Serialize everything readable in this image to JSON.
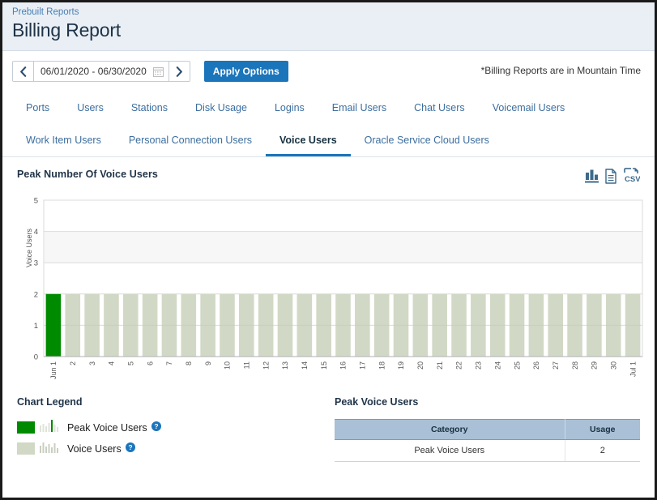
{
  "header": {
    "breadcrumb": "Prebuilt Reports",
    "title": "Billing Report"
  },
  "controls": {
    "prev_label": "‹",
    "next_label": "›",
    "date_range": "06/01/2020 - 06/30/2020",
    "calendar_icon": "calendar-icon",
    "apply_label": "Apply Options",
    "timezone_note": "*Billing Reports are in Mountain Time"
  },
  "tabs": {
    "row1": [
      {
        "label": "Ports",
        "active": false
      },
      {
        "label": "Users",
        "active": false
      },
      {
        "label": "Stations",
        "active": false
      },
      {
        "label": "Disk Usage",
        "active": false
      },
      {
        "label": "Logins",
        "active": false
      },
      {
        "label": "Email Users",
        "active": false
      },
      {
        "label": "Chat Users",
        "active": false
      },
      {
        "label": "Voicemail Users",
        "active": false
      }
    ],
    "row2": [
      {
        "label": "Work Item Users",
        "active": false
      },
      {
        "label": "Personal Connection Users",
        "active": false
      },
      {
        "label": "Voice Users",
        "active": true
      },
      {
        "label": "Oracle Service Cloud Users",
        "active": false
      }
    ]
  },
  "chart_panel": {
    "title": "Peak Number Of Voice Users",
    "actions": [
      {
        "name": "bar-chart-icon",
        "label": ""
      },
      {
        "name": "document-icon",
        "label": ""
      },
      {
        "name": "csv-icon",
        "label": "CSV"
      }
    ]
  },
  "chart_data": {
    "type": "bar",
    "title": "Peak Number Of Voice Users",
    "xlabel": "",
    "ylabel": "Voice Users",
    "ylim": [
      0,
      5
    ],
    "yticks": [
      0,
      1,
      2,
      3,
      4,
      5
    ],
    "grid": true,
    "legend_position": "below",
    "categories": [
      "Jun 1",
      "2",
      "3",
      "4",
      "5",
      "6",
      "7",
      "8",
      "9",
      "10",
      "11",
      "12",
      "13",
      "14",
      "15",
      "16",
      "17",
      "18",
      "19",
      "20",
      "21",
      "22",
      "23",
      "24",
      "25",
      "26",
      "27",
      "28",
      "29",
      "30",
      "Jul 1"
    ],
    "values": [
      2,
      2,
      2,
      2,
      2,
      2,
      2,
      2,
      2,
      2,
      2,
      2,
      2,
      2,
      2,
      2,
      2,
      2,
      2,
      2,
      2,
      2,
      2,
      2,
      2,
      2,
      2,
      2,
      2,
      2,
      2
    ],
    "peak_index": 0,
    "series": [
      {
        "name": "Peak Voice Users",
        "color": "#008a00"
      },
      {
        "name": "Voice Users",
        "color": "#d1d9c6"
      }
    ]
  },
  "legend": {
    "title": "Chart Legend",
    "items": [
      {
        "label": "Peak Voice Users",
        "color": "#008a00",
        "help": "help-icon"
      },
      {
        "label": "Voice Users",
        "color": "#d1d9c6",
        "help": "help-icon"
      }
    ]
  },
  "table": {
    "title": "Peak Voice Users",
    "columns": [
      "Category",
      "Usage"
    ],
    "rows": [
      {
        "category": "Peak Voice Users",
        "usage": "2"
      }
    ]
  },
  "colors": {
    "accent_blue": "#1b75bb",
    "header_bg": "#e9eff5",
    "peak_green": "#008a00",
    "bar_sage": "#d1d9c6",
    "table_header": "#a9c0d6"
  }
}
